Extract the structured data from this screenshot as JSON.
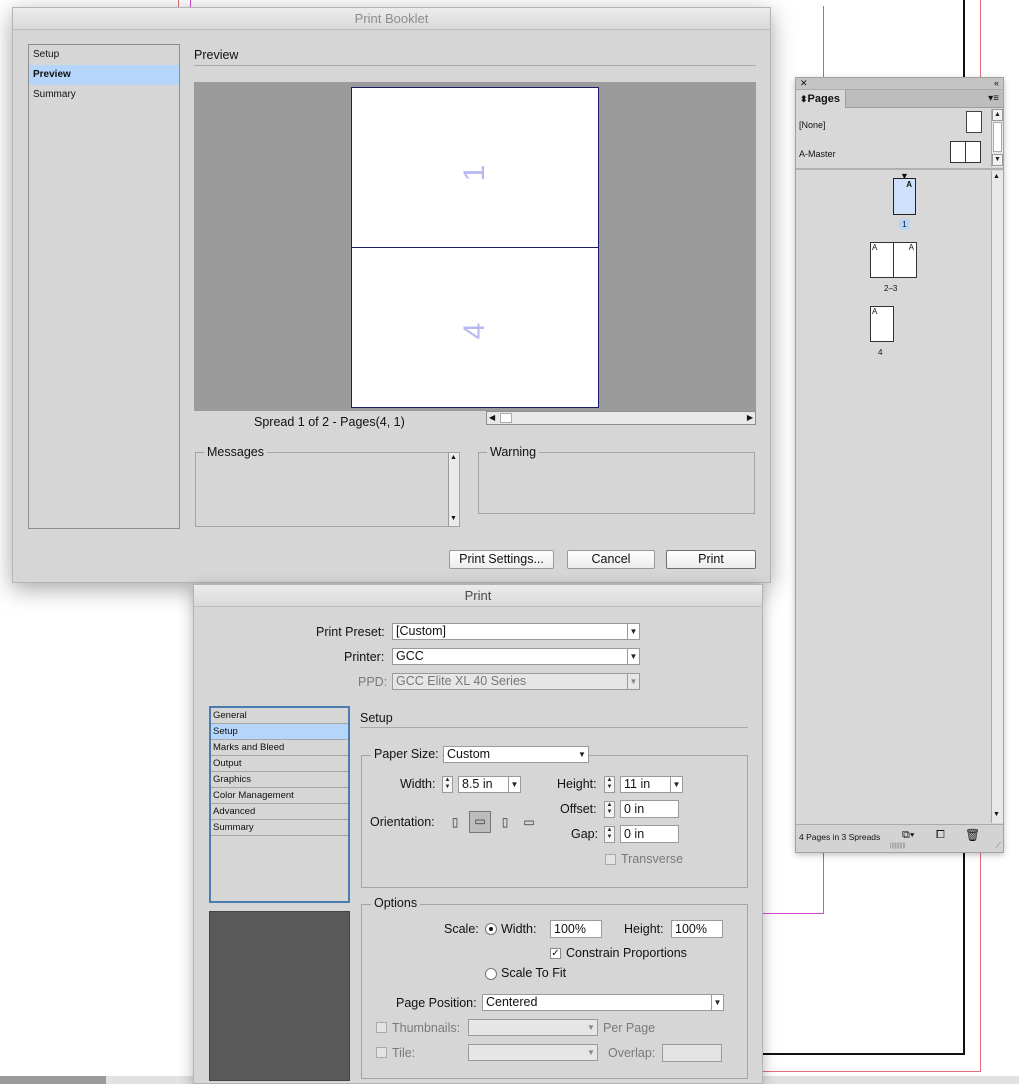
{
  "print_booklet": {
    "title": "Print Booklet",
    "nav": [
      "Setup",
      "Preview",
      "Summary"
    ],
    "nav_selected": 1,
    "section_title": "Preview",
    "preview": {
      "page_top_number": "1",
      "page_bottom_number": "4",
      "spread_label": "Spread 1 of 2 - Pages(4, 1)"
    },
    "messages_label": "Messages",
    "warning_label": "Warning",
    "buttons": {
      "print_settings": "Print Settings...",
      "cancel": "Cancel",
      "print": "Print"
    }
  },
  "print_dialog": {
    "title": "Print",
    "print_preset_label": "Print Preset:",
    "print_preset_value": "[Custom]",
    "printer_label": "Printer:",
    "printer_value": "GCC",
    "ppd_label": "PPD:",
    "ppd_value": "GCC Elite XL 40 Series",
    "nav": [
      "General",
      "Setup",
      "Marks and Bleed",
      "Output",
      "Graphics",
      "Color Management",
      "Advanced",
      "Summary"
    ],
    "nav_selected": 1,
    "section_title": "Setup",
    "paper_size_label": "Paper Size:",
    "paper_size_value": "Custom",
    "width_label": "Width:",
    "width_value": "8.5 in",
    "height_label": "Height:",
    "height_value": "11 in",
    "offset_label": "Offset:",
    "offset_value": "0 in",
    "gap_label": "Gap:",
    "gap_value": "0 in",
    "orientation_label": "Orientation:",
    "orientation_icons": [
      "portrait-icon",
      "landscape-icon",
      "reverse-portrait-icon",
      "reverse-landscape-icon"
    ],
    "orientation_selected": 1,
    "transverse_label": "Transverse",
    "options_label": "Options",
    "scale_label": "Scale:",
    "scale_width_label": "Width:",
    "scale_width_value": "100%",
    "scale_height_label": "Height:",
    "scale_height_value": "100%",
    "constrain_label": "Constrain Proportions",
    "constrain_checked": true,
    "scale_to_fit_label": "Scale To Fit",
    "page_position_label": "Page Position:",
    "page_position_value": "Centered",
    "thumbnails_label": "Thumbnails:",
    "per_page_label": "Per Page",
    "tile_label": "Tile:",
    "overlap_label": "Overlap:"
  },
  "pages_panel": {
    "tab_label": "Pages",
    "masters": [
      "[None]",
      "A-Master"
    ],
    "page_labels": [
      "1",
      "2–3",
      "4"
    ],
    "master_letter": "A",
    "footer_text": "4 Pages in 3 Spreads"
  },
  "colors": {
    "dialog_bg": "#d6d6d6",
    "selection": "#b5d5fb",
    "preview_bg": "#9b9b9b",
    "page_number": "#b9b9f0",
    "accent_border": "#4a7cb0"
  }
}
